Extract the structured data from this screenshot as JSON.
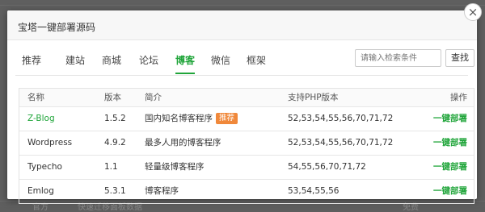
{
  "background": {
    "bottom_texts": [
      "官方",
      "快速迁移面板数据",
      "免费"
    ]
  },
  "modal": {
    "title": "宝塔一键部署源码",
    "close_symbol": "×"
  },
  "tabs": [
    {
      "label": "推荐",
      "active": false
    },
    {
      "label": "建站",
      "active": false
    },
    {
      "label": "商城",
      "active": false
    },
    {
      "label": "论坛",
      "active": false
    },
    {
      "label": "博客",
      "active": true
    },
    {
      "label": "微信",
      "active": false
    },
    {
      "label": "框架",
      "active": false
    }
  ],
  "search": {
    "placeholder": "请输入检索条件",
    "button_label": "查找"
  },
  "table": {
    "headers": {
      "name": "名称",
      "version": "版本",
      "description": "简介",
      "php": "支持PHP版本",
      "action": "操作"
    },
    "rows": [
      {
        "name": "Z-Blog",
        "version": "1.5.2",
        "description": "国内知名博客程序",
        "badge": "推荐",
        "php": "52,53,54,55,56,70,71,72",
        "action": "一键部署"
      },
      {
        "name": "Wordpress",
        "version": "4.9.2",
        "description": "最多人用的博客程序",
        "badge": "",
        "php": "52,53,54,55,56,70,71,72",
        "action": "一键部署"
      },
      {
        "name": "Typecho",
        "version": "1.1",
        "description": "轻量级博客程序",
        "badge": "",
        "php": "54,55,56,70,71,72",
        "action": "一键部署"
      },
      {
        "name": "Emlog",
        "version": "5.3.1",
        "description": "博客程序",
        "badge": "",
        "php": "53,54,55,56",
        "action": "一键部署"
      }
    ]
  },
  "colors": {
    "accent": "#20a53a",
    "badge": "#f0883a",
    "overlay": "#5f5f5f"
  }
}
